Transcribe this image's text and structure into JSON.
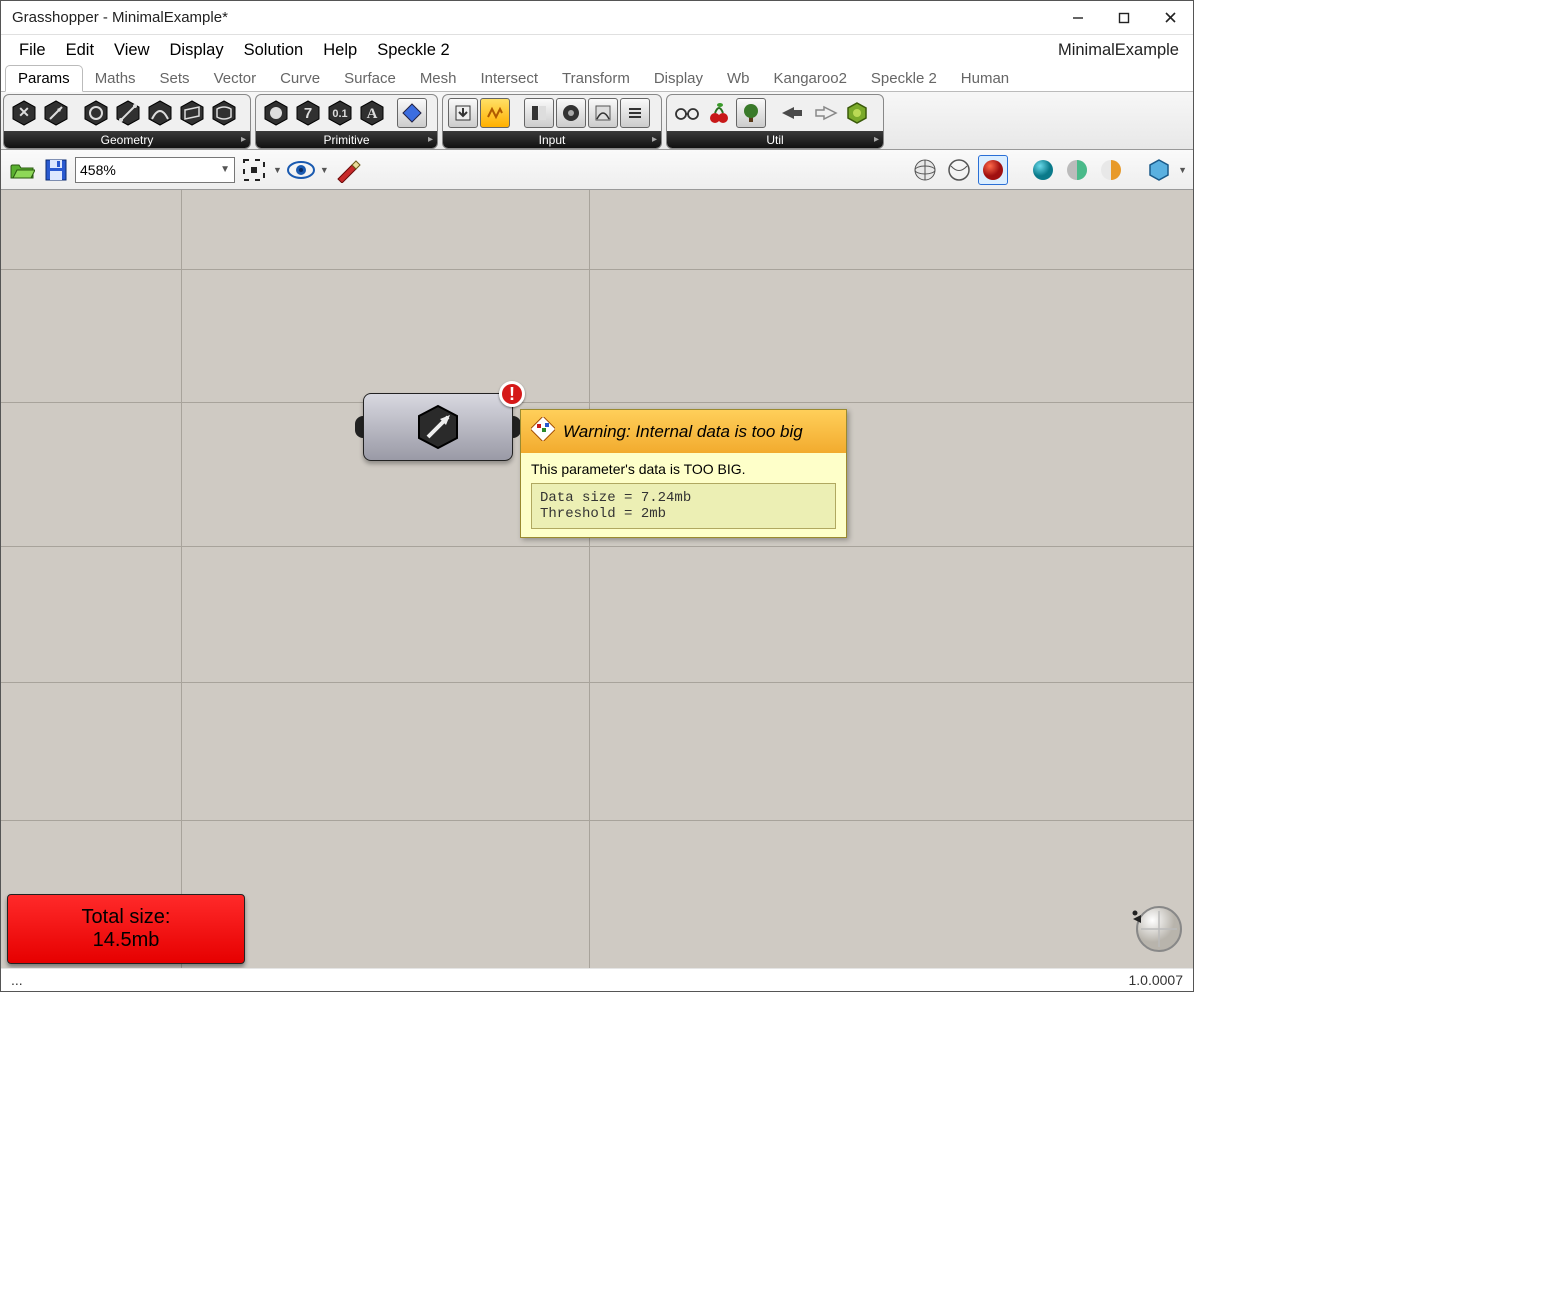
{
  "window": {
    "title": "Grasshopper - MinimalExample*"
  },
  "menu": {
    "items": [
      "File",
      "Edit",
      "View",
      "Display",
      "Solution",
      "Help",
      "Speckle 2"
    ],
    "document_name": "MinimalExample"
  },
  "ribbon": {
    "tabs": [
      "Params",
      "Maths",
      "Sets",
      "Vector",
      "Curve",
      "Surface",
      "Mesh",
      "Intersect",
      "Transform",
      "Display",
      "Wb",
      "Kangaroo2",
      "Speckle 2",
      "Human"
    ],
    "active_tab": "Params",
    "panels": {
      "geometry": {
        "label": "Geometry"
      },
      "primitive": {
        "label": "Primitive"
      },
      "input": {
        "label": "Input"
      },
      "util": {
        "label": "Util"
      }
    }
  },
  "canvas_toolbar": {
    "zoom": "458%"
  },
  "tooltip": {
    "title": "Warning: Internal data is too big",
    "body": "This parameter's data is TOO BIG.",
    "code": "Data size = 7.24mb\nThreshold = 2mb"
  },
  "total_size": {
    "label": "Total size:",
    "value": "14.5mb"
  },
  "status": {
    "left": "...",
    "version": "1.0.0007"
  }
}
